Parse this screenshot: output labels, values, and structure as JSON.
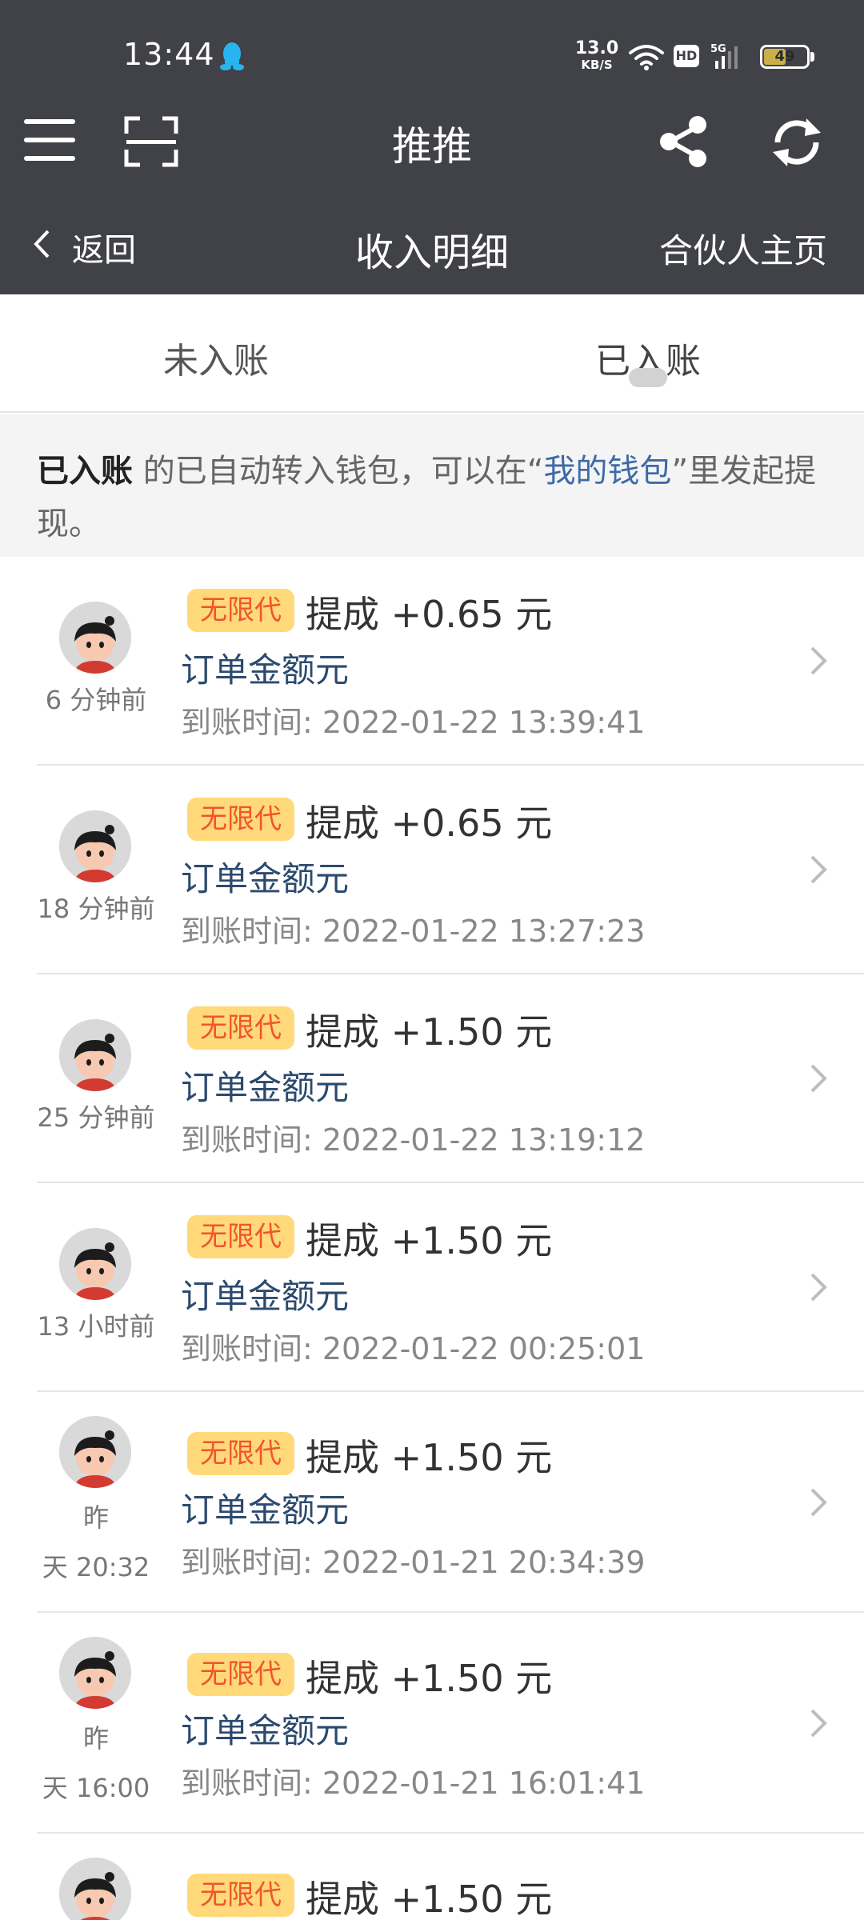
{
  "status_bar": {
    "time": "13:44",
    "net_speed_value": "13.0",
    "net_speed_unit": "KB/S",
    "hd_label": "HD",
    "signal_label": "5G",
    "battery_level": "49"
  },
  "app_bar": {
    "title": "推推"
  },
  "sub_nav": {
    "back_label": "返回",
    "title": "收入明细",
    "partner_link": "合伙人主页"
  },
  "tabs": {
    "unposted": "未入账",
    "posted": "已入账",
    "active": "posted"
  },
  "notice": {
    "bold_prefix": "已入账",
    "text_before_link": " 的已自动转入钱包，可以在“",
    "link_text": "我的钱包",
    "text_after_link": "”里发起提现。"
  },
  "records": [
    {
      "time_ago": "6 分钟前",
      "badge": "无限代",
      "commission": "提成 +0.65 元",
      "order_label": "订单金额元",
      "arrival": "到账时间: 2022-01-22 13:39:41"
    },
    {
      "time_ago": "18 分钟前",
      "badge": "无限代",
      "commission": "提成 +0.65 元",
      "order_label": "订单金额元",
      "arrival": "到账时间: 2022-01-22 13:27:23"
    },
    {
      "time_ago": "25 分钟前",
      "badge": "无限代",
      "commission": "提成 +1.50 元",
      "order_label": "订单金额元",
      "arrival": "到账时间: 2022-01-22 13:19:12"
    },
    {
      "time_ago": "13 小时前",
      "badge": "无限代",
      "commission": "提成 +1.50 元",
      "order_label": "订单金额元",
      "arrival": "到账时间: 2022-01-22 00:25:01"
    },
    {
      "time_ago_line1": "昨",
      "time_ago_line2": "天 20:32",
      "badge": "无限代",
      "commission": "提成 +1.50 元",
      "order_label": "订单金额元",
      "arrival": "到账时间: 2022-01-21 20:34:39"
    },
    {
      "time_ago_line1": "昨",
      "time_ago_line2": "天 16:00",
      "badge": "无限代",
      "commission": "提成 +1.50 元",
      "order_label": "订单金额元",
      "arrival": "到账时间: 2022-01-21 16:01:41"
    },
    {
      "badge": "无限代",
      "commission": "提成 +1.50 元"
    }
  ],
  "colors": {
    "header_bg": "#414247",
    "badge_bg": "#ffd97a",
    "badge_text": "#f0552e",
    "link": "#3d6aa8",
    "order_label": "#2c4a6e"
  },
  "icons": {
    "menu": "menu-icon",
    "scan": "scan-icon",
    "share": "share-icon",
    "refresh": "refresh-icon",
    "back": "chevron-left-icon",
    "row_arrow": "chevron-right-icon"
  }
}
